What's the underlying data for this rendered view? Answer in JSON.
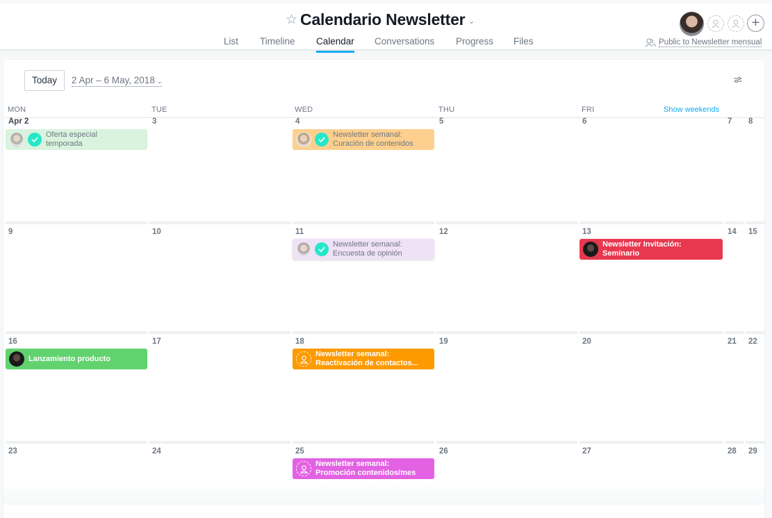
{
  "header": {
    "title": "Calendario Newsletter",
    "tabs": [
      {
        "label": "List",
        "active": false
      },
      {
        "label": "Timeline",
        "active": false
      },
      {
        "label": "Calendar",
        "active": true
      },
      {
        "label": "Conversations",
        "active": false
      },
      {
        "label": "Progress",
        "active": false
      },
      {
        "label": "Files",
        "active": false
      }
    ],
    "privacy_label": "Public to Newsletter mensual",
    "accent_color": "#14aaf5"
  },
  "toolbar": {
    "today_label": "Today",
    "date_range": "2 Apr – 6 May, 2018"
  },
  "calendar": {
    "weekday_headers": [
      "MON",
      "TUE",
      "WED",
      "THU",
      "FRI"
    ],
    "show_weekends_label": "Show weekends",
    "weeks": [
      {
        "days": [
          "Apr 2",
          "3",
          "4",
          "5",
          "6",
          "7",
          "8"
        ]
      },
      {
        "days": [
          "9",
          "10",
          "11",
          "12",
          "13",
          "14",
          "15"
        ]
      },
      {
        "days": [
          "16",
          "17",
          "18",
          "19",
          "20",
          "21",
          "22"
        ]
      },
      {
        "days": [
          "23",
          "24",
          "25",
          "26",
          "27",
          "28",
          "29"
        ]
      }
    ],
    "events": [
      {
        "title": "Oferta especial temporada",
        "line1": "Oferta especial",
        "line2": "temporada",
        "date": "Apr 2",
        "completed": true,
        "color": "#d9f3de",
        "assignee": "user-photo"
      },
      {
        "title": "Newsletter semanal: Curación de contenidos",
        "line1": "Newsletter semanal:",
        "line2": "Curación de contenidos",
        "date": "4",
        "completed": true,
        "color": "#fdd08f",
        "assignee": "user-photo"
      },
      {
        "title": "Newsletter semanal: Encuesta de opinión",
        "line1": "Newsletter semanal:",
        "line2": "Encuesta de opinión",
        "date": "11",
        "completed": true,
        "color": "#efe1f6",
        "assignee": "user-photo"
      },
      {
        "title": "Newsletter Invitación: Seminario",
        "line1": "Newsletter Invitación:",
        "line2": "Seminario",
        "date": "13",
        "completed": false,
        "color": "#e8384f",
        "assignee": "user-photo"
      },
      {
        "title": "Lanzamiento producto",
        "line1": "Lanzamiento producto",
        "line2": "",
        "date": "16",
        "completed": false,
        "color": "#62d26f",
        "assignee": "user-photo"
      },
      {
        "title": "Newsletter semanal: Reactivación de contactos...",
        "line1": "Newsletter semanal:",
        "line2": "Reactivación de contactos...",
        "date": "18",
        "completed": false,
        "color": "#fd9a00",
        "assignee": "unassigned"
      },
      {
        "title": "Newsletter semanal: Promoción contenidos/mes",
        "line1": "Newsletter semanal:",
        "line2": "Promoción contenidos/mes",
        "date": "25",
        "completed": false,
        "color": "#e362e3",
        "assignee": "unassigned"
      }
    ]
  }
}
